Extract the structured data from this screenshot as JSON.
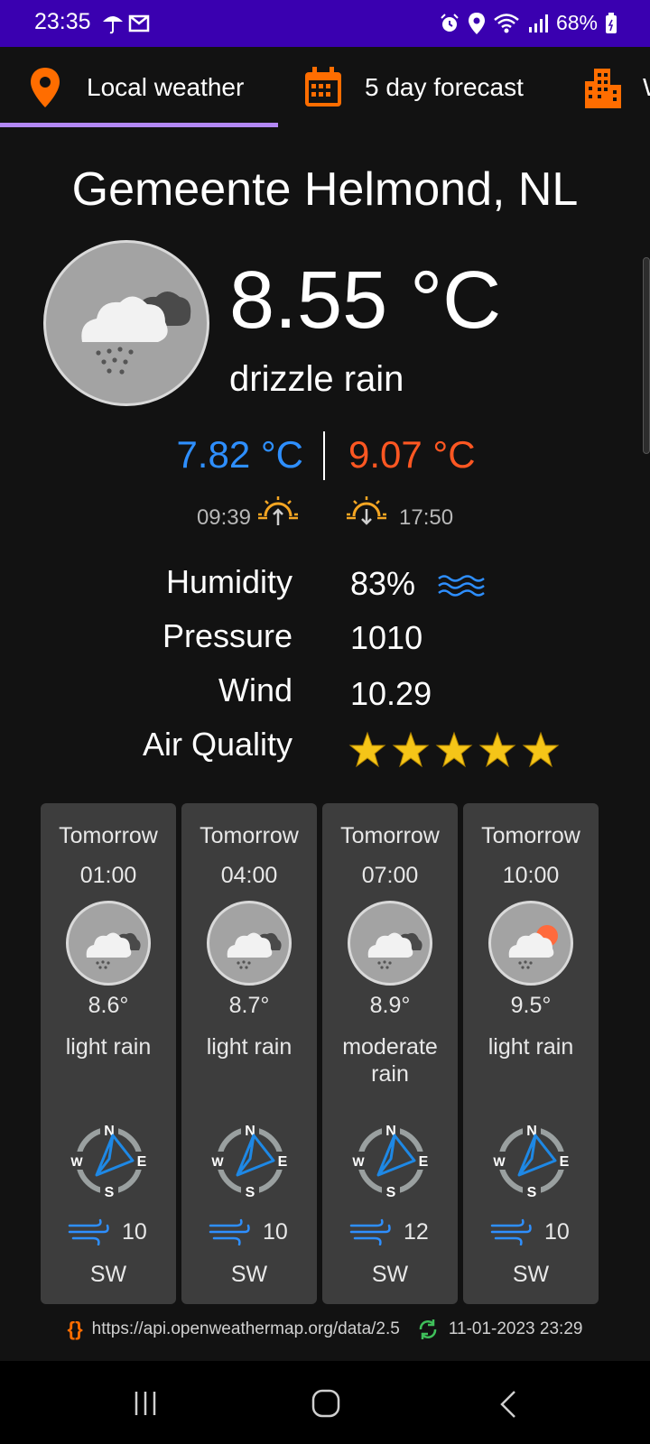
{
  "status": {
    "time": "23:35",
    "battery": "68%"
  },
  "tabs": [
    {
      "label": "Local weather",
      "icon": "location-pin-icon"
    },
    {
      "label": "5 day forecast",
      "icon": "calendar-icon"
    },
    {
      "label": "W",
      "icon": "city-icon"
    }
  ],
  "city": "Gemeente Helmond, NL",
  "current": {
    "temp": "8.55 °C",
    "desc": "drizzle rain",
    "tmin": "7.82 °C",
    "tmax": "9.07 °C",
    "sunrise": "09:39",
    "sunset": "17:50"
  },
  "details": {
    "humidity_label": "Humidity",
    "humidity": "83%",
    "pressure_label": "Pressure",
    "pressure": "1010",
    "wind_label": "Wind",
    "wind": "10.29",
    "air_label": "Air Quality",
    "air_stars": 5
  },
  "forecast": [
    {
      "day": "Tomorrow",
      "hour": "01:00",
      "temp": "8.6°",
      "desc": "light rain",
      "wind": "10",
      "dir": "SW",
      "sun": false
    },
    {
      "day": "Tomorrow",
      "hour": "04:00",
      "temp": "8.7°",
      "desc": "light rain",
      "wind": "10",
      "dir": "SW",
      "sun": false
    },
    {
      "day": "Tomorrow",
      "hour": "07:00",
      "temp": "8.9°",
      "desc": "moderate rain",
      "wind": "12",
      "dir": "SW",
      "sun": false
    },
    {
      "day": "Tomorrow",
      "hour": "10:00",
      "temp": "9.5°",
      "desc": "light rain",
      "wind": "10",
      "dir": "SW",
      "sun": true
    }
  ],
  "footer": {
    "api": "https://api.openweathermap.org/data/2.5",
    "updated": "11-01-2023 23:29"
  },
  "colors": {
    "accent": "#ff6d00",
    "statusbar": "#3a00b0",
    "cold": "#2e8fff",
    "hot": "#ff5722",
    "star": "#f5c518",
    "tab_indicator": "#b388f5"
  }
}
